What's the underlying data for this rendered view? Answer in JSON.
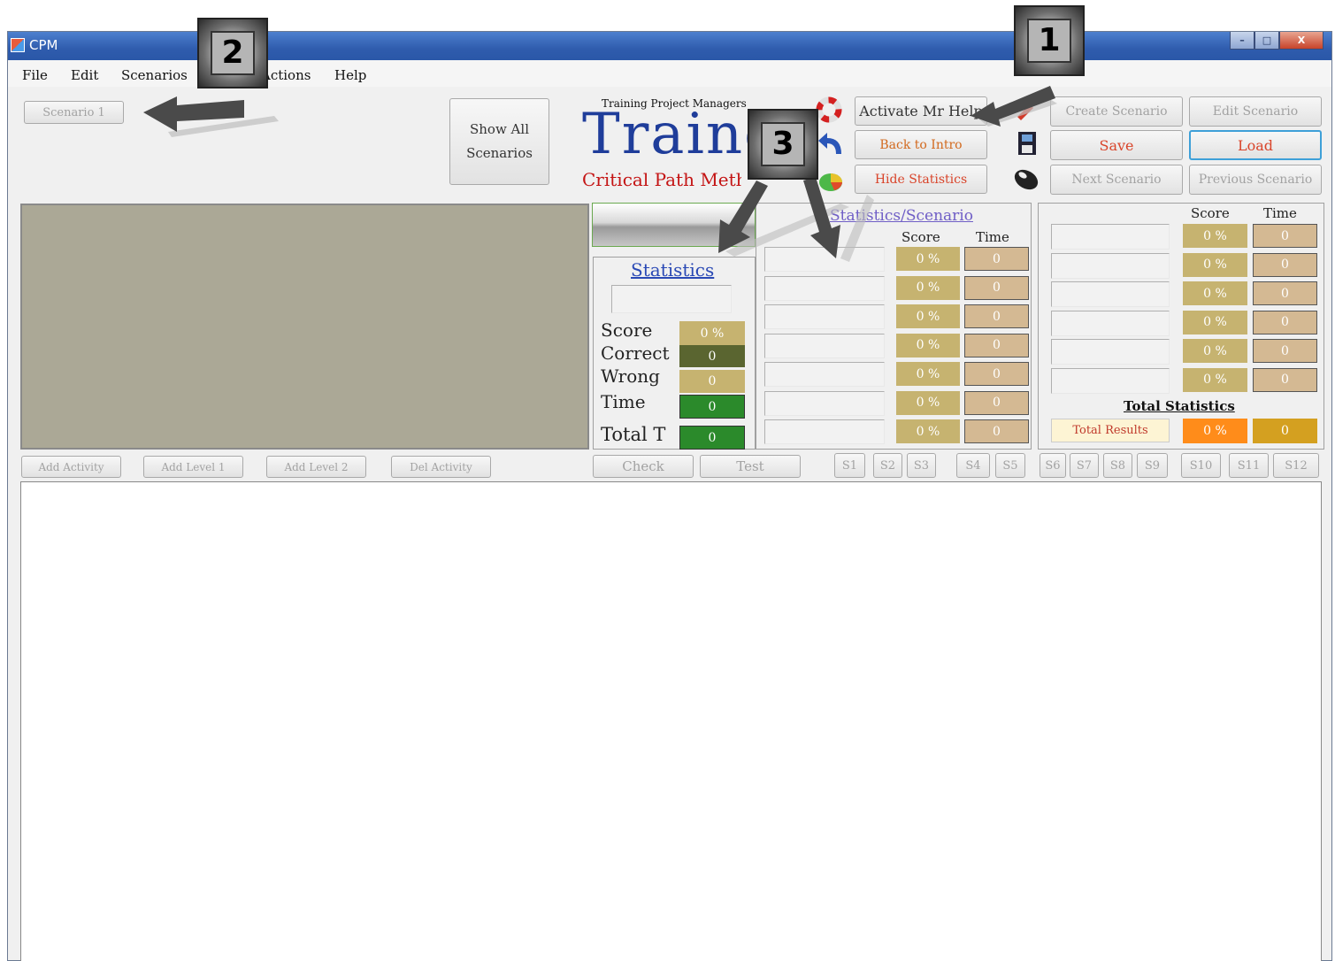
{
  "window": {
    "title": "CPM",
    "min_label": "–",
    "max_label": "□",
    "close_label": "X"
  },
  "menu": [
    "File",
    "Edit",
    "Scenarios",
    "Actions",
    "Help"
  ],
  "scenario_tab": "Scenario 1",
  "show_all": "Show All Scenarios",
  "logo": {
    "top": "Training Project Managers",
    "main": "Trainer",
    "sub": "Critical Path Method"
  },
  "buttons": {
    "activate_help": "Activate Mr Help",
    "back_intro": "Back to Intro",
    "hide_stats": "Hide Statistics",
    "create_scenario": "Create Scenario",
    "save": "Save",
    "next_scenario": "Next Scenario",
    "edit_scenario": "Edit Scenario",
    "load": "Load",
    "previous_scenario": "Previous Scenario"
  },
  "stats": {
    "title": "Statistics",
    "rows": [
      {
        "label": "Score",
        "value": "0 %"
      },
      {
        "label": "Correct",
        "value": "0"
      },
      {
        "label": "Wrong",
        "value": "0"
      },
      {
        "label": "Time",
        "value": "0"
      },
      {
        "label": "Total T",
        "value": "0"
      }
    ]
  },
  "scenario_stats": {
    "title": "Statistics/Scenario",
    "score_header": "Score",
    "time_header": "Time",
    "rows": [
      {
        "score": "0 %",
        "time": "0"
      },
      {
        "score": "0 %",
        "time": "0"
      },
      {
        "score": "0 %",
        "time": "0"
      },
      {
        "score": "0 %",
        "time": "0"
      },
      {
        "score": "0 %",
        "time": "0"
      },
      {
        "score": "0 %",
        "time": "0"
      },
      {
        "score": "0 %",
        "time": "0"
      }
    ]
  },
  "right_stats": {
    "score_header": "Score",
    "time_header": "Time",
    "rows": [
      {
        "score": "0 %",
        "time": "0"
      },
      {
        "score": "0 %",
        "time": "0"
      },
      {
        "score": "0 %",
        "time": "0"
      },
      {
        "score": "0 %",
        "time": "0"
      },
      {
        "score": "0 %",
        "time": "0"
      },
      {
        "score": "0 %",
        "time": "0"
      }
    ],
    "total_title": "Total Statistics",
    "total_label": "Total Results",
    "total_score": "0 %",
    "total_time": "0"
  },
  "toolbar": [
    "Add Activity",
    "Add Level 1",
    "Add Level 2",
    "Del Activity",
    "Check",
    "Test"
  ],
  "scenario_buttons": [
    "S1",
    "S2",
    "S3",
    "S4",
    "S5",
    "S6",
    "S7",
    "S8",
    "S9",
    "S10",
    "S11",
    "S12"
  ],
  "badges": [
    "1",
    "2",
    "3"
  ],
  "colors": {
    "correct": "#5a6530",
    "time": "#2b8a2b",
    "total_score": "#ff8c1a",
    "total_time": "#d4a020"
  }
}
